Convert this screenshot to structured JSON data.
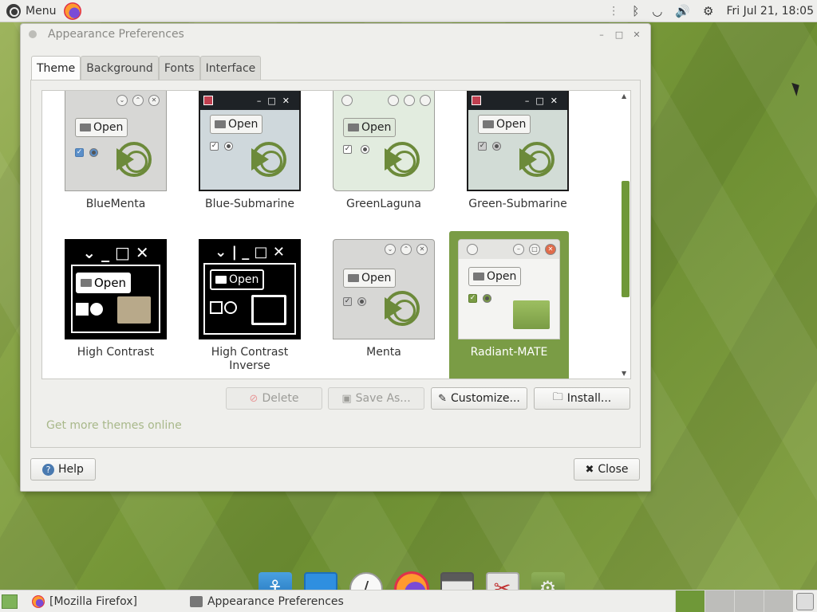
{
  "top_panel": {
    "menu_label": "Menu",
    "clock": "Fri Jul 21, 18:05",
    "tray_icons": [
      "separator-dots",
      "bluetooth-icon",
      "wifi-icon",
      "volume-icon",
      "gear-icon"
    ]
  },
  "dialog": {
    "title": "Appearance Preferences",
    "tabs": [
      {
        "label": "Theme",
        "active": true
      },
      {
        "label": "Background",
        "active": false
      },
      {
        "label": "Fonts",
        "active": false
      },
      {
        "label": "Interface",
        "active": false
      }
    ],
    "themes": [
      {
        "name": "BlueMenta",
        "selected": false
      },
      {
        "name": "Blue-Submarine",
        "selected": false
      },
      {
        "name": "GreenLaguna",
        "selected": false
      },
      {
        "name": "Green-Submarine",
        "selected": false
      },
      {
        "name": "High Contrast",
        "selected": false
      },
      {
        "name": "High Contrast Inverse",
        "selected": false
      },
      {
        "name": "Menta",
        "selected": false
      },
      {
        "name": "Radiant-MATE",
        "selected": true
      }
    ],
    "preview_open_label": "Open",
    "buttons": {
      "delete": "Delete",
      "save_as": "Save As...",
      "customize": "Customize...",
      "install": "Install..."
    },
    "get_more_link": "Get more themes online",
    "help": "Help",
    "close": "Close",
    "accent_color": "#7a9c45"
  },
  "dock": [
    "anchor-icon",
    "window-icon",
    "clock-icon",
    "firefox-icon",
    "file-cabinet-icon",
    "tools-icon",
    "package-icon"
  ],
  "bottom_panel": {
    "tasks": [
      {
        "label": "[Mozilla Firefox]"
      },
      {
        "label": "Appearance Preferences"
      }
    ]
  }
}
